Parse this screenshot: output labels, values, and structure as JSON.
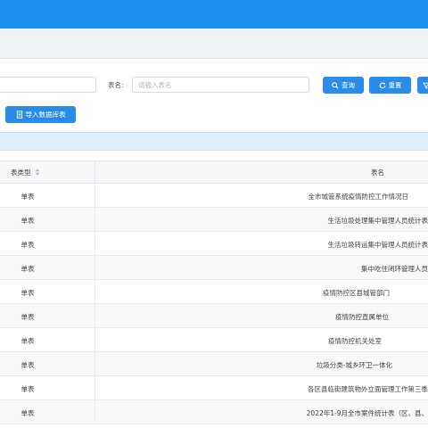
{
  "filters": {
    "table_name_label": "表名:",
    "table_name_placeholder": "请输入表名",
    "query_label": "查询",
    "reset_label": "重置"
  },
  "actions": {
    "import_label": "导入数据库表"
  },
  "table": {
    "headers": {
      "type": "表类型",
      "name": "表名"
    },
    "rows": [
      {
        "type": "单表",
        "name": "全市城管系统疫情防控工作情况日"
      },
      {
        "type": "单表",
        "name": "生活垃圾处理集中管理人员统计表"
      },
      {
        "type": "单表",
        "name": "生活垃圾转运集中管理人员统计表"
      },
      {
        "type": "单表",
        "name": "集中吃住闭环管理人员"
      },
      {
        "type": "单表",
        "name": "疫情防控区县城管部门"
      },
      {
        "type": "单表",
        "name": "疫情防控直属单位"
      },
      {
        "type": "单表",
        "name": "疫情防控机关处室"
      },
      {
        "type": "单表",
        "name": "垃圾分类-城乡环卫一体化"
      },
      {
        "type": "单表",
        "name": "各区县临街建筑物外立面管理工作第三季"
      },
      {
        "type": "单表",
        "name": "2022年1-9月全市案件统计表（区、县、"
      }
    ]
  },
  "colors": {
    "topbar": "#1e90f0",
    "primary_button": "#2a8ce8",
    "notice_bar": "#dfeef8"
  },
  "icons": {
    "query": "search-icon",
    "reset": "refresh-icon",
    "filter": "filter-icon",
    "import": "database-icon",
    "sort": "sort-icon"
  }
}
